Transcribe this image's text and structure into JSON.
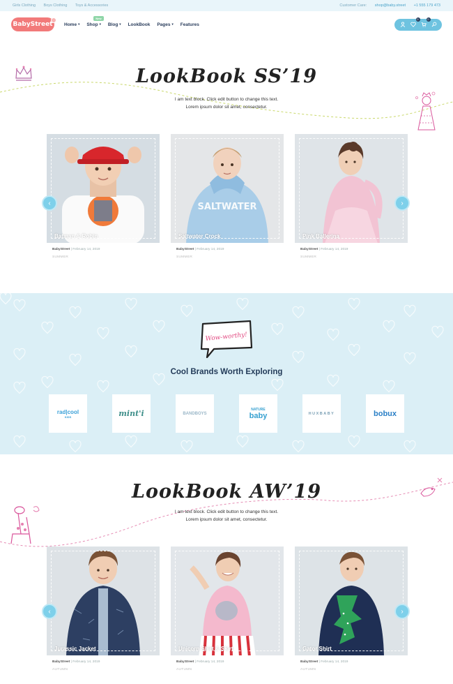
{
  "topbar": {
    "links": [
      "Girls Clothing",
      "Boys Clothing",
      "Toys & Accessories"
    ],
    "care_label": "Customer Care:",
    "email": "shop@baby.street",
    "phone": "+1 555 179 473"
  },
  "header": {
    "logo": "BabyStreet",
    "nav": [
      {
        "label": "Home",
        "caret": true
      },
      {
        "label": "Shop",
        "caret": true,
        "badge": "New"
      },
      {
        "label": "Blog",
        "caret": true
      },
      {
        "label": "LookBook",
        "caret": false
      },
      {
        "label": "Pages",
        "caret": true
      },
      {
        "label": "Features",
        "caret": false
      }
    ],
    "wishlist_count": "0",
    "cart_count": "0",
    "icons": [
      "user-icon",
      "heart-icon",
      "cart-icon",
      "search-icon"
    ]
  },
  "lookbook_ss": {
    "title": "LookBook SS’19",
    "text_line1": "I am text block. Click edit button to change this text.",
    "text_line2": "Lorem ipsum dolor sit amet, consectetur.",
    "cards": [
      {
        "caption": "Batman & Robin",
        "author": "BabyStreet",
        "date": "February 14, 2019",
        "category": "SUMMER"
      },
      {
        "caption": "Saltwater Crock",
        "author": "BabyStreet",
        "date": "February 14, 2019",
        "category": "SUMMER"
      },
      {
        "caption": "Pink Ballerina",
        "author": "BabyStreet",
        "date": "February 14, 2019",
        "category": "SUMMER"
      }
    ]
  },
  "brands": {
    "bubble_text": "Wow-worthy!",
    "title": "Cool Brands Worth Exploring",
    "logos": [
      {
        "name": "rad|cool",
        "sub": "KIDS",
        "color": "#3aa0d8"
      },
      {
        "name": "mint'i",
        "sub": "",
        "color": "#3f8f8a"
      },
      {
        "name": "BANDBOYS",
        "sub": "",
        "color": "#9bb7c8"
      },
      {
        "name": "NATURE",
        "sub": "baby",
        "color": "#36a0d0"
      },
      {
        "name": "HUXBABY",
        "sub": "",
        "color": "#7a9fb4"
      },
      {
        "name": "bobux",
        "sub": "",
        "color": "#2a7fc6"
      }
    ]
  },
  "lookbook_aw": {
    "title": "LookBook AW’19",
    "text_line1": "I am text block. Click edit button to change this text.",
    "text_line2": "Lorem ipsum dolor sit amet, consectetur.",
    "cards": [
      {
        "caption": "Jurassic Jacket",
        "author": "BabyStreet",
        "date": "February 14, 2019",
        "category": "AUTUMN"
      },
      {
        "caption": "Unicorn Shirt & Skirt",
        "author": "BabyStreet",
        "date": "February 14, 2019",
        "category": "AUTUMN"
      },
      {
        "caption": "Gator Shirt",
        "author": "BabyStreet",
        "date": "February 14, 2019",
        "category": "AUTUMN"
      }
    ]
  },
  "colors": {
    "accent": "#6ec3e0",
    "logo": "#f27a7a",
    "nav_text": "#2a3d5c",
    "brands_bg": "#dbeff6"
  }
}
